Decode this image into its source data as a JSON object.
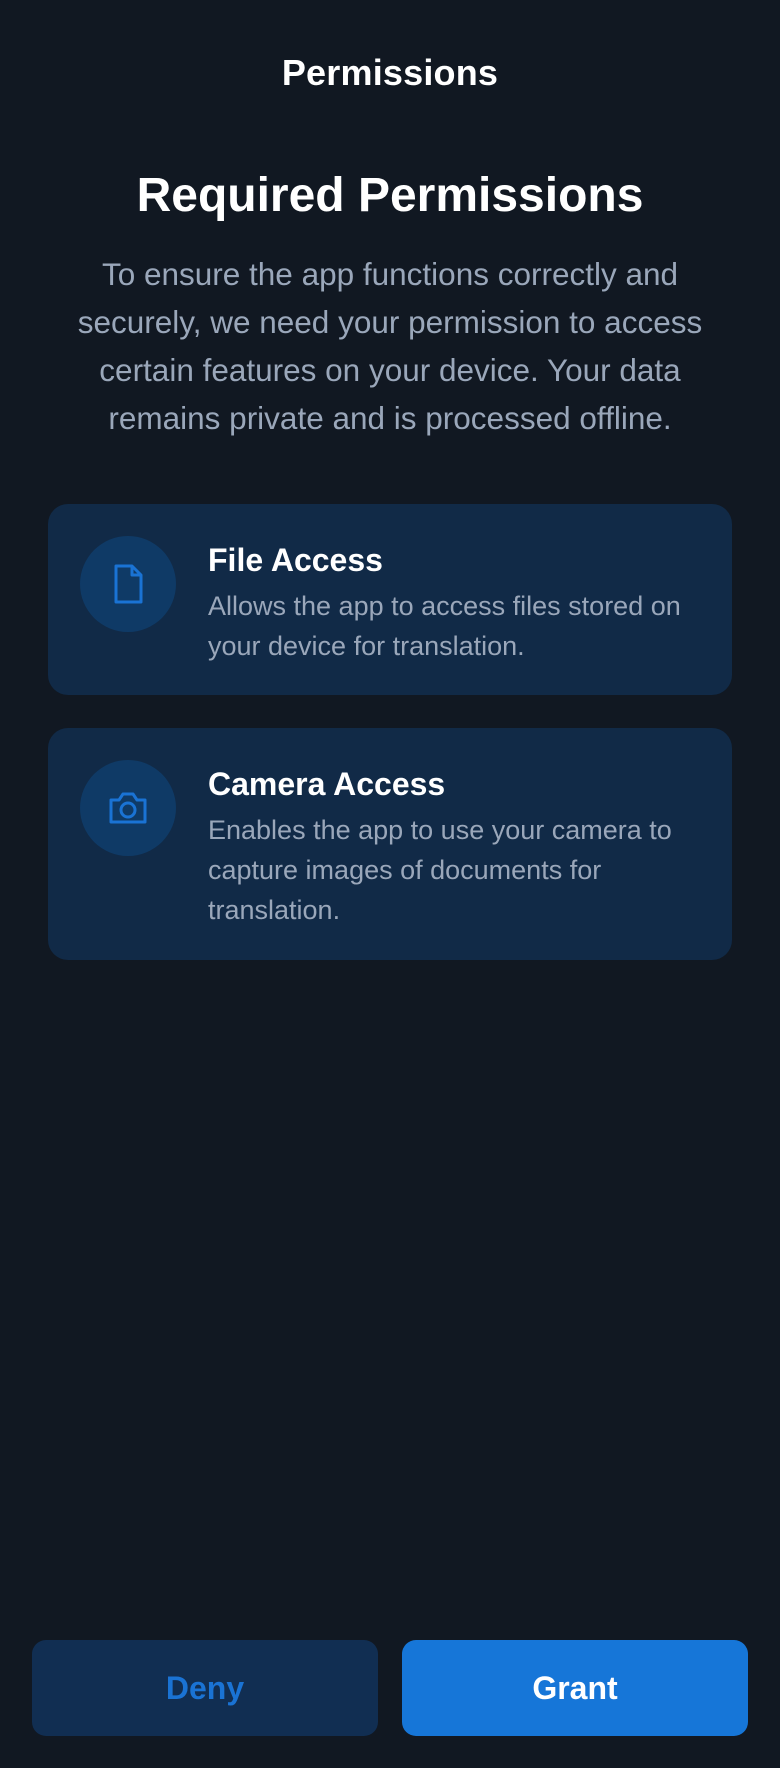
{
  "app_bar": {
    "title": "Permissions"
  },
  "main": {
    "heading": "Required Permissions",
    "intro": "To ensure the app functions correctly and securely, we need your permission to access certain features on your device. Your data remains private and is processed offline."
  },
  "permissions": [
    {
      "icon": "file-icon",
      "title": "File Access",
      "description": "Allows the app to access files stored on your device for translation."
    },
    {
      "icon": "camera-icon",
      "title": "Camera Access",
      "description": "Enables the app to use your camera to capture images of documents for translation."
    }
  ],
  "actions": {
    "deny_label": "Deny",
    "grant_label": "Grant"
  },
  "colors": {
    "background": "#111822",
    "card": "#112a47",
    "icon_circle": "#0f3a66",
    "accent": "#1676d8",
    "muted_text": "#9aa7ba"
  }
}
